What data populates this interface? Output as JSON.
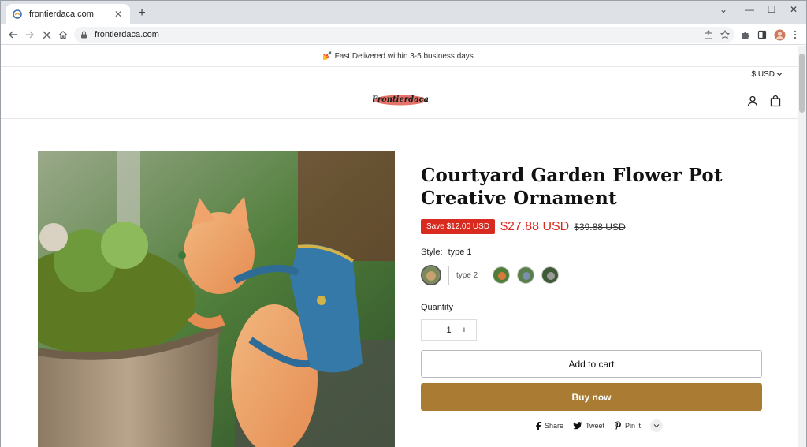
{
  "browser": {
    "tab_title": "frontierdaca.com",
    "url": "frontierdaca.com",
    "new_tab_symbol": "+",
    "close_symbol": "✕",
    "window_controls": [
      "⌄",
      "—",
      "☐",
      "✕"
    ]
  },
  "store": {
    "announcement": "💅 Fast Delivered within 3-5 business days.",
    "currency": "$ USD",
    "logo_text": "Frontierdaca",
    "accent_color": "#a97b33",
    "sale_color": "#d92a1f"
  },
  "product": {
    "title": "Courtyard Garden Flower Pot Creative Ornament",
    "save_badge": "Save $12.00 USD",
    "price": "$27.88 USD",
    "compare_price": "$39.88 USD",
    "style_label": "Style:",
    "style_value": "type 1",
    "type2_label": "type 2",
    "quantity_label": "Quantity",
    "quantity": "1",
    "minus": "−",
    "plus": "+",
    "add_to_cart": "Add to cart",
    "buy_now": "Buy now"
  },
  "share": {
    "facebook": "Share",
    "twitter": "Tweet",
    "pinterest": "Pin it"
  }
}
